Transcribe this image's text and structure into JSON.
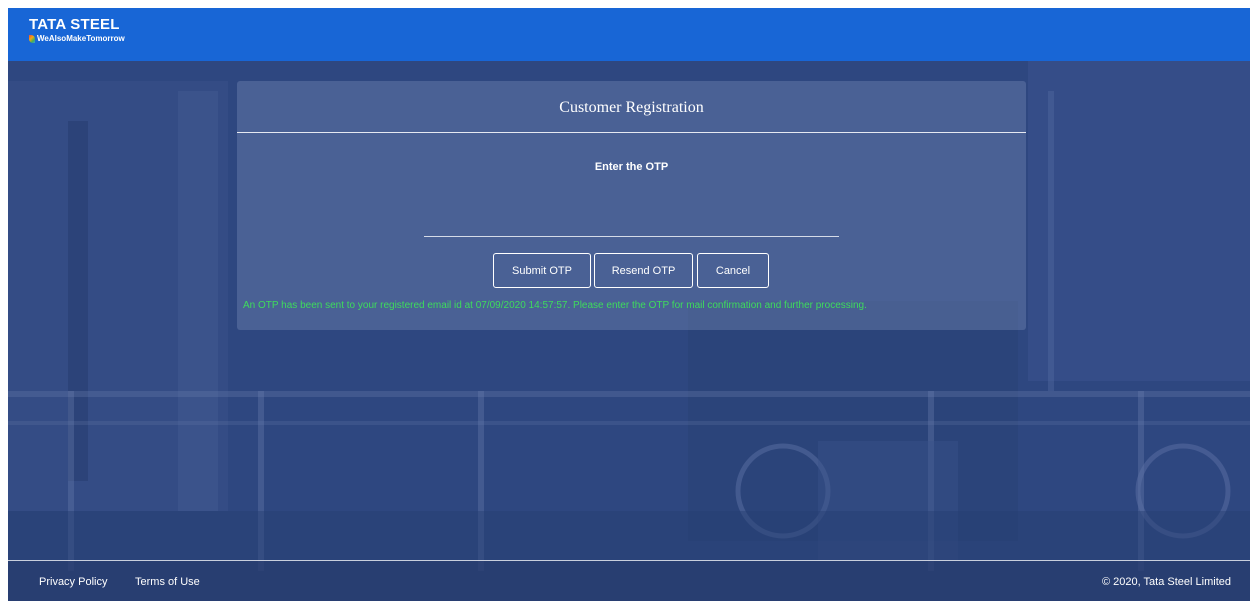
{
  "header": {
    "brand": "TATA STEEL",
    "tagline": "WeAlsoMakeTomorrow"
  },
  "card": {
    "title": "Customer Registration",
    "otp_label": "Enter the OTP",
    "otp_value": "",
    "buttons": {
      "submit": "Submit OTP",
      "resend": "Resend OTP",
      "cancel": "Cancel"
    },
    "message": "An OTP has been sent to your registered email id at 07/09/2020 14:57:57. Please enter the OTP for mail confirmation and further processing."
  },
  "footer": {
    "privacy": "Privacy Policy",
    "terms": "Terms of Use",
    "copyright": "© 2020, Tata Steel Limited"
  },
  "colors": {
    "header_bg": "#1866d6",
    "message": "#3edc5c",
    "page_bg": "#2d4680"
  },
  "icons": {
    "logo_leaf": "tata-steel-leaf-icon"
  }
}
